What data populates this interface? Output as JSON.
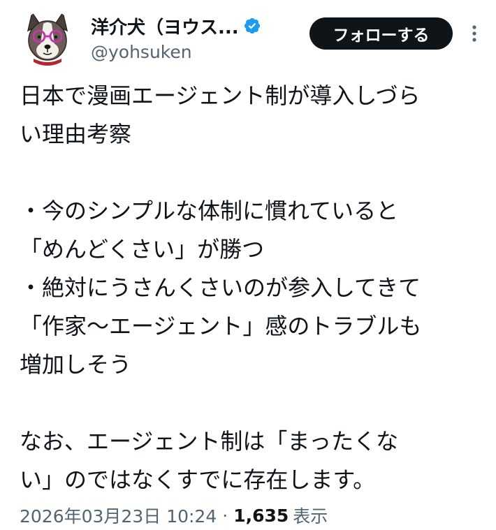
{
  "author": {
    "display_name": "洋介犬（ヨウス...",
    "handle": "@yohsuken",
    "verified_icon": "verified-badge-icon",
    "avatar_icon": "dog-avatar-icon"
  },
  "actions": {
    "follow_label": "フォローする",
    "more_icon": "more-vertical-icon"
  },
  "tweet": {
    "lines": [
      "日本で漫画エージェント制が導入しづら",
      "い理由考察",
      "",
      "・今のシンプルな体制に慣れていると",
      "「めんどくさい」が勝つ",
      "・絶対にうさんくさいのが参入してきて",
      "「作家〜エージェント」感のトラブルも",
      "増加しそう",
      "",
      "なお、エージェント制は「まったくな",
      "い」のではなくすでに存在します。"
    ]
  },
  "meta": {
    "timestamp": "2026年03月23日 10:24",
    "separator": "·",
    "views_count": "1,635",
    "views_label": "表示"
  },
  "colors": {
    "text_primary": "#0f1419",
    "text_secondary": "#536471",
    "verified_blue": "#1d9bf0",
    "follow_bg": "#0f1419"
  }
}
